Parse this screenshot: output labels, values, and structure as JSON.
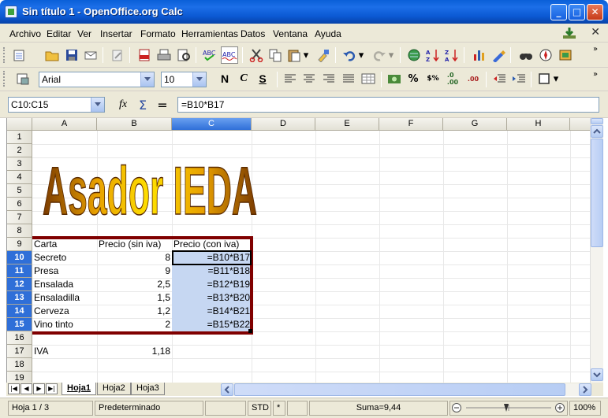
{
  "window": {
    "title": "Sin título 1 - OpenOffice.org Calc"
  },
  "menu": [
    "Archivo",
    "Editar",
    "Ver",
    "Insertar",
    "Formato",
    "Herramientas",
    "Datos",
    "Ventana",
    "Ayuda"
  ],
  "formatting": {
    "font_name": "Arial",
    "font_size": "10",
    "bold": "N",
    "italic": "C",
    "underline": "S"
  },
  "formula_bar": {
    "name_box": "C10:C15",
    "formula": "=B10*B17",
    "fx_symbol": "fx",
    "sum_symbol": "Σ",
    "equal_symbol": "="
  },
  "columns": [
    "A",
    "B",
    "C",
    "D",
    "E",
    "F",
    "G",
    "H"
  ],
  "rows": [
    "1",
    "2",
    "3",
    "4",
    "5",
    "6",
    "7",
    "8",
    "9",
    "10",
    "11",
    "12",
    "13",
    "14",
    "15",
    "16",
    "17",
    "18",
    "19"
  ],
  "wordart": "Asador IEDA",
  "table": {
    "headers": [
      "Carta",
      "Precio (sin iva)",
      "Precio (con iva)"
    ],
    "items": [
      {
        "name": "Secreto",
        "price": "8",
        "formula": "=B10*B17"
      },
      {
        "name": "Presa",
        "price": "9",
        "formula": "=B11*B18"
      },
      {
        "name": "Ensalada",
        "price": "2,5",
        "formula": "=B12*B19"
      },
      {
        "name": "Ensaladilla",
        "price": "1,5",
        "formula": "=B13*B20"
      },
      {
        "name": "Cerveza",
        "price": "1,2",
        "formula": "=B14*B21"
      },
      {
        "name": "Vino tinto",
        "price": "2",
        "formula": "=B15*B22"
      }
    ],
    "iva_label": "IVA",
    "iva_value": "1,18"
  },
  "sheets": [
    "Hoja1",
    "Hoja2",
    "Hoja3"
  ],
  "status": {
    "sheet": "Hoja 1 / 3",
    "style": "Predeterminado",
    "mode": "STD",
    "modified": "*",
    "sum": "Suma=9,44",
    "zoom": "100%"
  },
  "colors": {
    "selection": "#c6d7f2",
    "border": "#800000",
    "header_selected": "#2f6fd8"
  }
}
